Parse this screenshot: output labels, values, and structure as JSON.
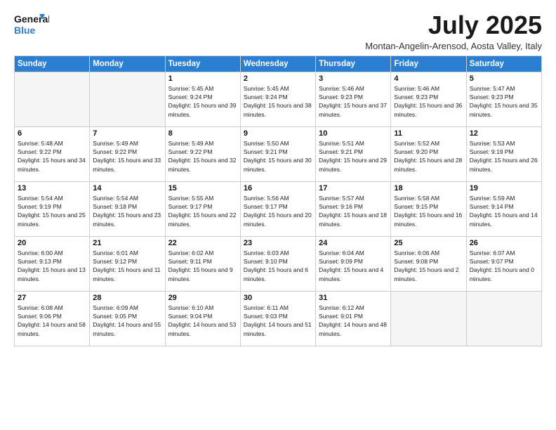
{
  "logo": {
    "line1": "General",
    "line2": "Blue"
  },
  "title": "July 2025",
  "location": "Montan-Angelin-Arensod, Aosta Valley, Italy",
  "days_of_week": [
    "Sunday",
    "Monday",
    "Tuesday",
    "Wednesday",
    "Thursday",
    "Friday",
    "Saturday"
  ],
  "weeks": [
    [
      {
        "day": "",
        "empty": true
      },
      {
        "day": "",
        "empty": true
      },
      {
        "day": "1",
        "sunrise": "5:45 AM",
        "sunset": "9:24 PM",
        "daylight": "15 hours and 39 minutes."
      },
      {
        "day": "2",
        "sunrise": "5:45 AM",
        "sunset": "9:24 PM",
        "daylight": "15 hours and 38 minutes."
      },
      {
        "day": "3",
        "sunrise": "5:46 AM",
        "sunset": "9:23 PM",
        "daylight": "15 hours and 37 minutes."
      },
      {
        "day": "4",
        "sunrise": "5:46 AM",
        "sunset": "9:23 PM",
        "daylight": "15 hours and 36 minutes."
      },
      {
        "day": "5",
        "sunrise": "5:47 AM",
        "sunset": "9:23 PM",
        "daylight": "15 hours and 35 minutes."
      }
    ],
    [
      {
        "day": "6",
        "sunrise": "5:48 AM",
        "sunset": "9:22 PM",
        "daylight": "15 hours and 34 minutes."
      },
      {
        "day": "7",
        "sunrise": "5:49 AM",
        "sunset": "9:22 PM",
        "daylight": "15 hours and 33 minutes."
      },
      {
        "day": "8",
        "sunrise": "5:49 AM",
        "sunset": "9:22 PM",
        "daylight": "15 hours and 32 minutes."
      },
      {
        "day": "9",
        "sunrise": "5:50 AM",
        "sunset": "9:21 PM",
        "daylight": "15 hours and 30 minutes."
      },
      {
        "day": "10",
        "sunrise": "5:51 AM",
        "sunset": "9:21 PM",
        "daylight": "15 hours and 29 minutes."
      },
      {
        "day": "11",
        "sunrise": "5:52 AM",
        "sunset": "9:20 PM",
        "daylight": "15 hours and 28 minutes."
      },
      {
        "day": "12",
        "sunrise": "5:53 AM",
        "sunset": "9:19 PM",
        "daylight": "15 hours and 26 minutes."
      }
    ],
    [
      {
        "day": "13",
        "sunrise": "5:54 AM",
        "sunset": "9:19 PM",
        "daylight": "15 hours and 25 minutes."
      },
      {
        "day": "14",
        "sunrise": "5:54 AM",
        "sunset": "9:18 PM",
        "daylight": "15 hours and 23 minutes."
      },
      {
        "day": "15",
        "sunrise": "5:55 AM",
        "sunset": "9:17 PM",
        "daylight": "15 hours and 22 minutes."
      },
      {
        "day": "16",
        "sunrise": "5:56 AM",
        "sunset": "9:17 PM",
        "daylight": "15 hours and 20 minutes."
      },
      {
        "day": "17",
        "sunrise": "5:57 AM",
        "sunset": "9:16 PM",
        "daylight": "15 hours and 18 minutes."
      },
      {
        "day": "18",
        "sunrise": "5:58 AM",
        "sunset": "9:15 PM",
        "daylight": "15 hours and 16 minutes."
      },
      {
        "day": "19",
        "sunrise": "5:59 AM",
        "sunset": "9:14 PM",
        "daylight": "15 hours and 14 minutes."
      }
    ],
    [
      {
        "day": "20",
        "sunrise": "6:00 AM",
        "sunset": "9:13 PM",
        "daylight": "15 hours and 13 minutes."
      },
      {
        "day": "21",
        "sunrise": "6:01 AM",
        "sunset": "9:12 PM",
        "daylight": "15 hours and 11 minutes."
      },
      {
        "day": "22",
        "sunrise": "6:02 AM",
        "sunset": "9:11 PM",
        "daylight": "15 hours and 9 minutes."
      },
      {
        "day": "23",
        "sunrise": "6:03 AM",
        "sunset": "9:10 PM",
        "daylight": "15 hours and 6 minutes."
      },
      {
        "day": "24",
        "sunrise": "6:04 AM",
        "sunset": "9:09 PM",
        "daylight": "15 hours and 4 minutes."
      },
      {
        "day": "25",
        "sunrise": "6:06 AM",
        "sunset": "9:08 PM",
        "daylight": "15 hours and 2 minutes."
      },
      {
        "day": "26",
        "sunrise": "6:07 AM",
        "sunset": "9:07 PM",
        "daylight": "15 hours and 0 minutes."
      }
    ],
    [
      {
        "day": "27",
        "sunrise": "6:08 AM",
        "sunset": "9:06 PM",
        "daylight": "14 hours and 58 minutes."
      },
      {
        "day": "28",
        "sunrise": "6:09 AM",
        "sunset": "9:05 PM",
        "daylight": "14 hours and 55 minutes."
      },
      {
        "day": "29",
        "sunrise": "6:10 AM",
        "sunset": "9:04 PM",
        "daylight": "14 hours and 53 minutes."
      },
      {
        "day": "30",
        "sunrise": "6:11 AM",
        "sunset": "9:03 PM",
        "daylight": "14 hours and 51 minutes."
      },
      {
        "day": "31",
        "sunrise": "6:12 AM",
        "sunset": "9:01 PM",
        "daylight": "14 hours and 48 minutes."
      },
      {
        "day": "",
        "empty": true
      },
      {
        "day": "",
        "empty": true
      }
    ]
  ]
}
